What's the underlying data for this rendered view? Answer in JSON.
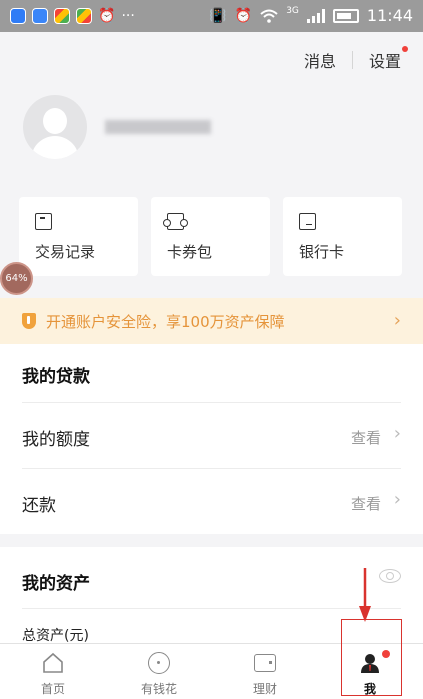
{
  "status_bar": {
    "time": "11:44",
    "network": "3G",
    "icons": [
      "baidu-app-icon",
      "baidu-app-icon",
      "chrome-icon",
      "chrome-icon",
      "alarm-icon",
      "more-icon",
      "vibrate-icon",
      "alarm-icon",
      "wifi-icon",
      "signal-icon",
      "battery-icon"
    ]
  },
  "header": {
    "messages_label": "消息",
    "settings_label": "设置"
  },
  "quick_cards": [
    {
      "label": "交易记录",
      "icon": "transaction-record-icon"
    },
    {
      "label": "卡券包",
      "icon": "coupon-icon"
    },
    {
      "label": "银行卡",
      "icon": "bank-card-icon"
    }
  ],
  "floating_badge": {
    "text": "64%"
  },
  "banner": {
    "text": "开通账户安全险，享100万资产保障"
  },
  "loan_section": {
    "title": "我的贷款",
    "rows": [
      {
        "name": "我的额度",
        "action": "查看"
      },
      {
        "name": "还款",
        "action": "查看"
      }
    ]
  },
  "assets_section": {
    "title": "我的资产",
    "total_label": "总资产(元)"
  },
  "tabbar": {
    "tabs": [
      {
        "label": "首页",
        "icon": "home-icon"
      },
      {
        "label": "有钱花",
        "icon": "coin-icon"
      },
      {
        "label": "理财",
        "icon": "wallet-icon"
      },
      {
        "label": "我",
        "icon": "user-icon",
        "active": true
      }
    ]
  },
  "colors": {
    "accent_red": "#d9332e",
    "banner_bg": "#fdf2dd",
    "banner_text": "#e5943a",
    "notification_dot": "#f0413b"
  }
}
